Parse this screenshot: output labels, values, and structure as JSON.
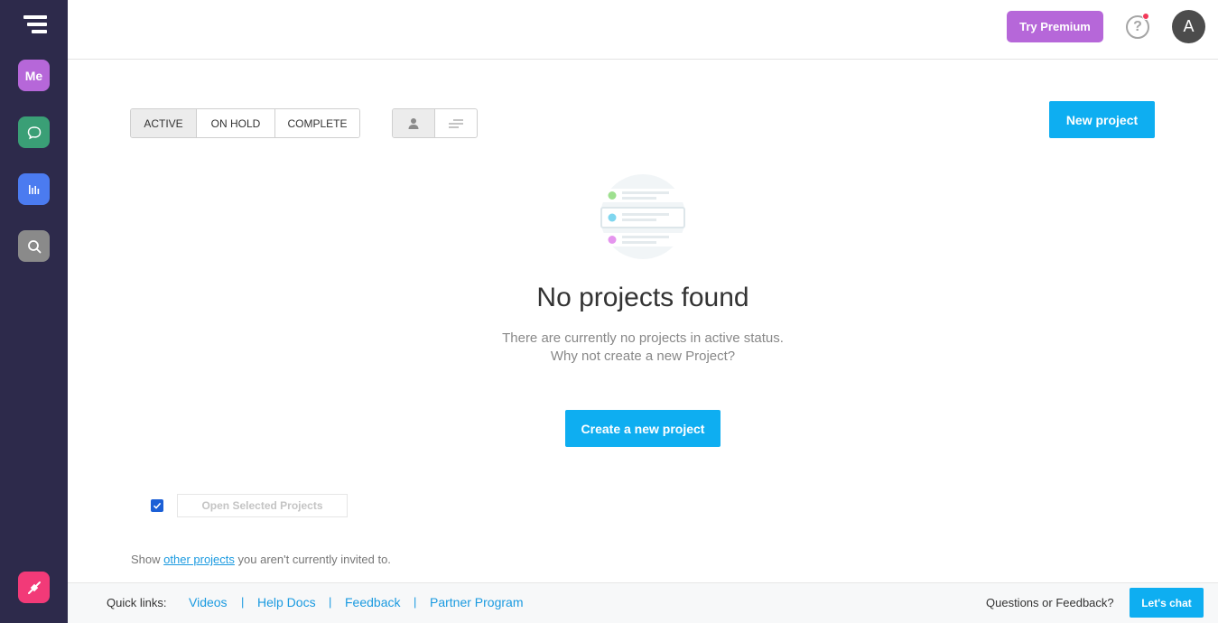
{
  "sidebar": {
    "logo_icon": "stacked-bars-logo",
    "items": [
      {
        "label": "Me",
        "icon": "me-badge",
        "color": "#b667d9"
      },
      {
        "label": "",
        "icon": "chat-bubble-icon",
        "color": "#3a9f76"
      },
      {
        "label": "",
        "icon": "bar-chart-icon",
        "color": "#4b7bf0"
      },
      {
        "label": "",
        "icon": "search-icon",
        "color": "#8a8a8a"
      }
    ],
    "bottom_item": {
      "icon": "plug-icon",
      "color": "#f23a78"
    }
  },
  "topbar": {
    "try_premium": "Try Premium",
    "help_glyph": "?",
    "avatar_initial": "A",
    "premium_color": "#b667d9"
  },
  "filters": {
    "tabs": [
      {
        "label": "ACTIVE",
        "active": true
      },
      {
        "label": "ON HOLD",
        "active": false
      },
      {
        "label": "COMPLETE",
        "active": false
      }
    ],
    "view_buttons": [
      {
        "icon": "person-icon",
        "active": true
      },
      {
        "icon": "sort-lines-icon",
        "active": false
      }
    ]
  },
  "actions": {
    "new_project": "New project",
    "create_new_project": "Create a new project",
    "open_selected": "Open Selected Projects",
    "accent_color": "#0eaef1"
  },
  "empty_state": {
    "illustration_icon": "project-list-illustration",
    "title": "No projects found",
    "line1": "There are currently no projects in active status.",
    "line2": "Why not create a new Project?"
  },
  "other_projects": {
    "prefix": "Show ",
    "link": "other projects",
    "suffix": " you aren't currently invited to."
  },
  "footer": {
    "quick_links_label": "Quick links:",
    "links": [
      "Videos",
      "Help Docs",
      "Feedback",
      "Partner Program"
    ],
    "separator": "|",
    "questions": "Questions or Feedback?",
    "lets_chat": "Let's chat"
  }
}
